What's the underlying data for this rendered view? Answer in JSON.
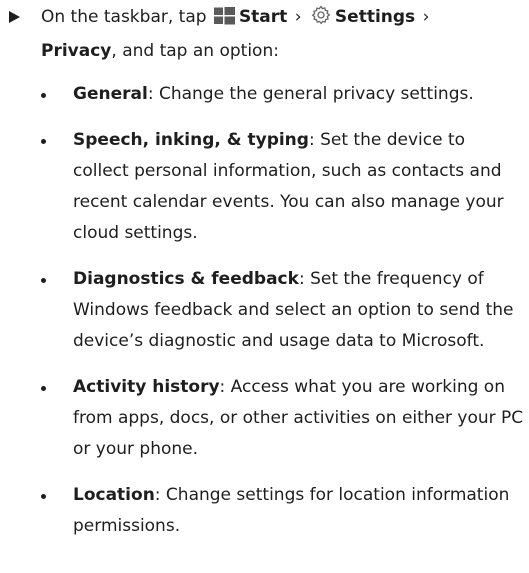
{
  "instruction": {
    "intro": "On the taskbar, tap",
    "start_label": "Start",
    "separator": "›",
    "settings_label": "Settings",
    "privacy_label": "Privacy",
    "outro": ", and tap an option:"
  },
  "options": [
    {
      "term": "General",
      "desc": ": Change the general privacy settings."
    },
    {
      "term": "Speech, inking, & typing",
      "desc": ": Set the device to collect personal information, such as contacts and recent calendar events. You can also manage your cloud settings."
    },
    {
      "term": "Diagnostics & feedback",
      "desc": ": Set the frequency of Windows feedback and select an option to send the device’s diagnostic and usage data to Microsoft."
    },
    {
      "term": "Activity history",
      "desc": ": Access what you are working on from apps, docs, or other activities on either your PC or your phone."
    },
    {
      "term": "Location",
      "desc": ": Change settings for location information permissions."
    }
  ],
  "icons": {
    "step_marker": "arrow-right-icon",
    "start": "windows-start-icon",
    "settings": "gear-icon",
    "bullet": "bullet-icon"
  },
  "colors": {
    "text": "#1e1e1e",
    "start_icon": "#5a5a5a",
    "gear_icon": "#666666"
  }
}
